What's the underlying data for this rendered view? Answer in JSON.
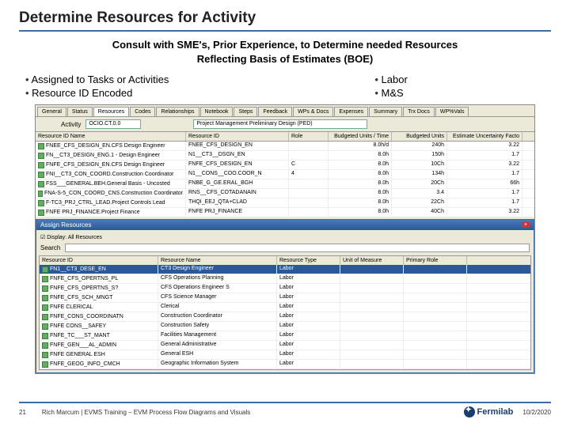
{
  "title": "Determine Resources for Activity",
  "subtitle_l1": "Consult with SME's, Prior Experience, to Determine needed Resources",
  "subtitle_l2": "Reflecting Basis of Estimates (BOE)",
  "bullets_left": [
    "Assigned to Tasks or Activities",
    "Resource ID Encoded"
  ],
  "bullets_right": [
    "Labor",
    "M&S"
  ],
  "tabs": [
    "General",
    "Status",
    "Resources",
    "Codes",
    "Relationships",
    "Notebook",
    "Steps",
    "Feedback",
    "WPs & Docs",
    "Expenses",
    "Summary",
    "Trx Docs",
    "WP%Vals"
  ],
  "filter": {
    "activity_lbl": "Activity",
    "activity_val": "OCIO.CT.0.0",
    "task_lbl": "",
    "task_val": "Project Management Preliminary Design (PED)"
  },
  "gcols": [
    "Resource ID Name",
    "Resource ID",
    "Role",
    "Budgeted Units / Time",
    "Budgeted Units",
    "Estimate Uncertainty Facto"
  ],
  "grows": [
    {
      "c1": "FNEE_CFS_DESIGN_EN.CFS Design Engineer",
      "c2": "FNEE_CFS_DESIGN_EN",
      "c3": "",
      "c4": "8.0h/d",
      "c5": "240h",
      "c6": "3.22"
    },
    {
      "c1": "FN__CT3_DESIGN_ENG.1 - Design Engineer",
      "c2": "N1__CT3__DSGN_EN",
      "c3": "",
      "c4": "8.0h",
      "c5": "150h",
      "c6": "1.7"
    },
    {
      "c1": "FNFE_CFS_DESIGN_EN.CFS Design Engineer",
      "c2": "FNFE_CFS_DESIGN_EN",
      "c3": "C",
      "c4": "8.0h",
      "c5": "10Ch",
      "c6": "3.22"
    },
    {
      "c1": "FNI__CT3_CON_COORD.Construction Coordinator",
      "c2": "N1__CONS__COO.COOR_N",
      "c3": "4",
      "c4": "8.0h",
      "c5": "134h",
      "c6": "1.7"
    },
    {
      "c1": "FSS___GENERAL.BEH.General Basis - Uncosted",
      "c2": "FNBE_G_GE.ERAL_BGH",
      "c3": "",
      "c4": "8.0h",
      "c5": "20Ch",
      "c6": "66h"
    },
    {
      "c1": "FNA-S-5_CON_COORD_CNS.Construction Coordinator",
      "c2": "RNS__CFS_COTADANAIN",
      "c3": "",
      "c4": "8.0h",
      "c5": "3.4",
      "c6": "1.7"
    },
    {
      "c1": "F-TC3_PRJ_CTRL_LEAD.Project Controls Lead",
      "c2": "THQI_EEJ_QTA+CLAD",
      "c3": "",
      "c4": "8.0h",
      "c5": "22Ch",
      "c6": "1.7"
    },
    {
      "c1": "FNFE PRJ_FINANCE.Project Finance",
      "c2": "FNFE PRJ_FINANCE",
      "c3": "",
      "c4": "8.0h",
      "c5": "40Ch",
      "c6": "3.22"
    }
  ],
  "subwin": {
    "title": "Assign Resources",
    "check": "Display: All Resources",
    "search_lbl": "Search",
    "cols": [
      "Resource ID",
      "Resource Name",
      "Resource Type",
      "Unit of Measure",
      "Primary Role"
    ],
    "rows": [
      {
        "s1": "FN1__CT3_DESE_EN",
        "s2": "CT3 Design Engineer",
        "s3": "Labor",
        "s4": "",
        "s5": "",
        "sel": true
      },
      {
        "s1": "FNFE_CFS_OPERTNS_PL",
        "s2": "CFS Operations Planning",
        "s3": "Labor",
        "s4": "",
        "s5": ""
      },
      {
        "s1": "FNFE_CFS_OPERTNS_S?",
        "s2": "CFS Operations Engineer S",
        "s3": "Labor",
        "s4": "",
        "s5": ""
      },
      {
        "s1": "FNFE_CFS_SCH_MNGT",
        "s2": "CFS Science Manager",
        "s3": "Labor",
        "s4": "",
        "s5": ""
      },
      {
        "s1": "FNFE CLERICAL",
        "s2": "Clerical",
        "s3": "Labor",
        "s4": "",
        "s5": ""
      },
      {
        "s1": "FNFE_CONS_COORDINATN",
        "s2": "Construction Coordinator",
        "s3": "Labor",
        "s4": "",
        "s5": ""
      },
      {
        "s1": "FNFE CONS__SAFEY",
        "s2": "Construction Safety",
        "s3": "Labor",
        "s4": "",
        "s5": ""
      },
      {
        "s1": "FNFE_TC___ST_MANT",
        "s2": "Facilities Management",
        "s3": "Labor",
        "s4": "",
        "s5": ""
      },
      {
        "s1": "FNFE_GEN___AL_ADMIN",
        "s2": "General Administrative",
        "s3": "Labor",
        "s4": "",
        "s5": ""
      },
      {
        "s1": "FNFE GENERAL ESH",
        "s2": "General ESH",
        "s3": "Labor",
        "s4": "",
        "s5": ""
      },
      {
        "s1": "FNFE_GEOG_INFO_CMCH",
        "s2": "Geographic Information System",
        "s3": "Labor",
        "s4": "",
        "s5": ""
      }
    ]
  },
  "footer": {
    "page": "21",
    "text": "Rich Marcum | EVMS Training – EVM Process Flow Diagrams and Visuals",
    "date": "10/2/2020",
    "logo": "Fermilab"
  }
}
